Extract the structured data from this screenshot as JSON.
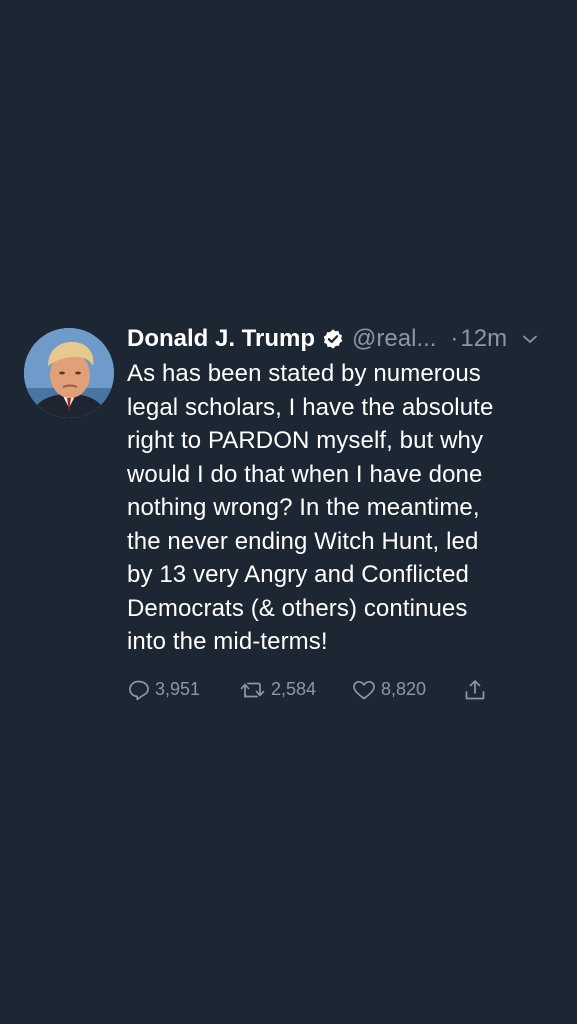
{
  "tweet": {
    "name": "Donald J. Trump",
    "handle": "@real...",
    "dot": "·",
    "time": "12m",
    "text": "As has been stated by numerous\nlegal scholars, I have the absolute\nright to PARDON myself, but why\nwould I do that when I have done\nnothing wrong? In the meantime,\nthe never ending Witch Hunt, led\nby 13 very Angry and Conflicted\nDemocrats (& others) continues\ninto the mid-terms!",
    "actions": {
      "replies": "3,951",
      "retweets": "2,584",
      "likes": "8,820"
    }
  },
  "icons": {
    "verified": "verified-badge-icon",
    "chevron": "chevron-down-icon",
    "reply": "reply-icon",
    "retweet": "retweet-icon",
    "like": "heart-icon",
    "share": "share-icon"
  },
  "colors": {
    "background": "#1c2733",
    "primary_text": "#ffffff",
    "secondary_text": "#8899a6"
  }
}
